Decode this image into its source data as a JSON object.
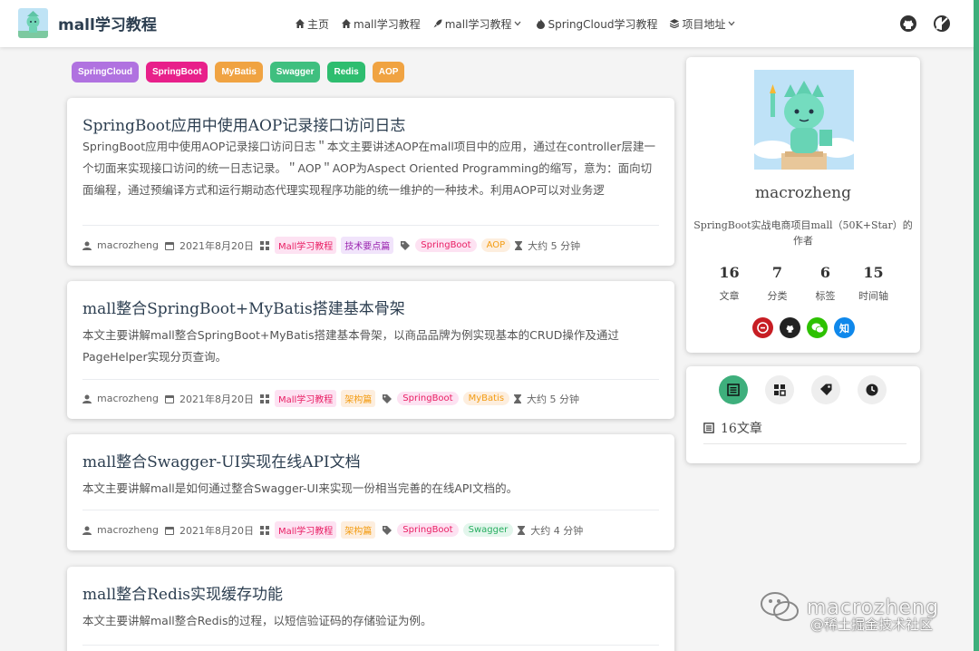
{
  "colors": {
    "accent": "#3eaf7c"
  },
  "header": {
    "title": "mall学习教程",
    "nav": [
      {
        "label": "主页",
        "icon": "home-icon"
      },
      {
        "label": "mall学习教程",
        "icon": "home-icon"
      },
      {
        "label": "mall学习教程",
        "icon": "rocket-icon",
        "dropdown": true
      },
      {
        "label": "SpringCloud学习教程",
        "icon": "fire-icon"
      },
      {
        "label": "项目地址",
        "icon": "layers-icon",
        "dropdown": true
      }
    ],
    "right_icons": [
      "github-icon",
      "theme-toggle-icon"
    ]
  },
  "tags": [
    {
      "label": "SpringCloud",
      "color": "#b072e0"
    },
    {
      "label": "SpringBoot",
      "color": "#e8208a"
    },
    {
      "label": "MyBatis",
      "color": "#f0a342"
    },
    {
      "label": "Swagger",
      "color": "#3fbf7f"
    },
    {
      "label": "Redis",
      "color": "#2ebd6f"
    },
    {
      "label": "AOP",
      "color": "#f0a342"
    }
  ],
  "posts": [
    {
      "title": "SpringBoot应用中使用AOP记录接口访问日志",
      "description": "SpringBoot应用中使用AOP记录接口访问日志＂本文主要讲述AOP在mall项目中的应用，通过在controller层建一个切面来实现接口访问的统一日志记录。＂AOP＂AOP为Aspect Oriented Programming的缩写，意为：面向切面编程，通过预编译方式和运行期动态代理实现程序功能的统一维护的一种技术。利用AOP可以对业务逻",
      "author": "macrozheng",
      "date": "2021年8月20日",
      "categories": [
        "Mall学习教程",
        "技术要点篇"
      ],
      "tags": [
        "SpringBoot",
        "AOP"
      ],
      "read_time": "大约 5 分钟"
    },
    {
      "title": "mall整合SpringBoot+MyBatis搭建基本骨架",
      "description": "本文主要讲解mall整合SpringBoot+MyBatis搭建基本骨架，以商品品牌为例实现基本的CRUD操作及通过PageHelper实现分页查询。",
      "author": "macrozheng",
      "date": "2021年8月20日",
      "categories": [
        "Mall学习教程",
        "架构篇"
      ],
      "tags": [
        "SpringBoot",
        "MyBatis"
      ],
      "read_time": "大约 5 分钟"
    },
    {
      "title": "mall整合Swagger-UI实现在线API文档",
      "description": "本文主要讲解mall是如何通过整合Swagger-UI来实现一份相当完善的在线API文档的。",
      "author": "macrozheng",
      "date": "2021年8月20日",
      "categories": [
        "Mall学习教程",
        "架构篇"
      ],
      "tags": [
        "SpringBoot",
        "Swagger"
      ],
      "read_time": "大约 4 分钟"
    },
    {
      "title": "mall整合Redis实现缓存功能",
      "description": "本文主要讲解mall整合Redis的过程，以短信验证码的存储验证为例。"
    }
  ],
  "profile": {
    "name": "macrozheng",
    "bio": "SpringBoot实战电商项目mall（50K+Star）的作者",
    "stats": [
      {
        "value": "16",
        "label": "文章"
      },
      {
        "value": "7",
        "label": "分类"
      },
      {
        "value": "6",
        "label": "标签"
      },
      {
        "value": "15",
        "label": "时间轴"
      }
    ],
    "socials": [
      {
        "icon": "gitee-icon",
        "color": "#c71d23",
        "glyph": "G"
      },
      {
        "icon": "github-icon",
        "color": "#222222",
        "glyph": ""
      },
      {
        "icon": "wechat-icon",
        "color": "#2dc100",
        "glyph": ""
      },
      {
        "icon": "zhihu-icon",
        "color": "#0f88eb",
        "glyph": "知"
      }
    ]
  },
  "blog_panel": {
    "tabs": [
      "article-icon",
      "category-icon",
      "tag-icon",
      "timeline-icon"
    ],
    "article_count_text": "16文章"
  },
  "watermark": {
    "name": "macrozheng",
    "sub": "@稀土掘金技术社区"
  }
}
